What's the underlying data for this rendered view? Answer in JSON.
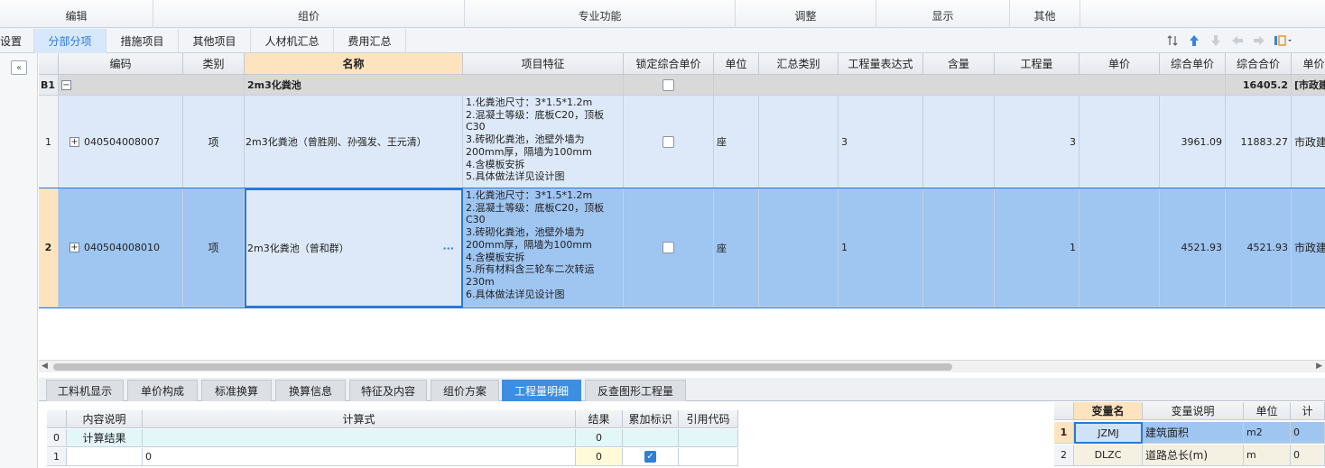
{
  "ribbon": {
    "groups": [
      "编辑",
      "组价",
      "专业功能",
      "调整",
      "显示",
      "其他"
    ]
  },
  "tabs": {
    "items": [
      "设置",
      "分部分项",
      "措施项目",
      "其他项目",
      "人材机汇总",
      "费用汇总"
    ],
    "active": "分部分项"
  },
  "grid": {
    "headers": [
      "编码",
      "类别",
      "名称",
      "项目特征",
      "锁定综合单价",
      "单位",
      "汇总类别",
      "工程量表达式",
      "含量",
      "工程量",
      "单价",
      "综合单价",
      "综合合价",
      "单价"
    ],
    "section": {
      "no": "B1",
      "toggle": "−",
      "name": "2m3化粪池",
      "total": "16405.2",
      "category": "[市政建"
    },
    "rows": [
      {
        "no": "1",
        "code": "040504008007",
        "type": "项",
        "name": "2m3化粪池（曾胜刚、孙强发、王元清）",
        "features": "1.化粪池尺寸：3*1.5*1.2m\n2.混凝土等级：底板C20，顶板\nC30\n3.砖砌化粪池，池壁外墙为\n200mm厚，隔墙为100mm\n4.含模板安拆\n5.具体做法详见设计图",
        "unit": "座",
        "expr": "3",
        "qty": "3",
        "unit_price": "3961.09",
        "total": "11883.27",
        "cat": "市政建"
      },
      {
        "no": "2",
        "code": "040504008010",
        "type": "项",
        "name": "2m3化粪池（曾和群）",
        "more": "···",
        "features": "1.化粪池尺寸：3*1.5*1.2m\n2.混凝土等级：底板C20，顶板\nC30\n3.砖砌化粪池，池壁外墙为\n200mm厚，隔墙为100mm\n4.含模板安拆\n5.所有材料含三轮车二次转运\n230m\n6.具体做法详见设计图",
        "unit": "座",
        "expr": "1",
        "qty": "1",
        "unit_price": "4521.93",
        "total": "4521.93",
        "cat": "市政建"
      }
    ]
  },
  "bottom_tabs": {
    "items": [
      "工料机显示",
      "单价构成",
      "标准换算",
      "换算信息",
      "特征及内容",
      "组价方案",
      "工程量明细",
      "反查图形工程量"
    ],
    "active": "工程量明细"
  },
  "calc_table": {
    "headers": [
      "内容说明",
      "计算式",
      "结果",
      "累加标识",
      "引用代码"
    ],
    "rows": [
      {
        "no": "0",
        "desc": "计算结果",
        "formula": "",
        "result": "0",
        "accumulate": false,
        "ref": ""
      },
      {
        "no": "1",
        "desc": "",
        "formula": "0",
        "result": "0",
        "accumulate": true,
        "ref": ""
      }
    ]
  },
  "var_table": {
    "headers": [
      "变量名",
      "变量说明",
      "单位",
      "计"
    ],
    "rows": [
      {
        "no": "1",
        "name": "JZMJ",
        "desc": "建筑面积",
        "unit": "m2",
        "val": "0"
      },
      {
        "no": "2",
        "name": "DLZC",
        "desc": "道路总长(m)",
        "unit": "m",
        "val": "0"
      }
    ]
  },
  "colors": {
    "accent": "#2b78d8",
    "selected_row": "#9fc5f1",
    "row_bg": "#dde9f8",
    "section_bg": "#d9d9d9",
    "active_tab": "#3d8ee0"
  },
  "icons": [
    "collapse-left-icon",
    "move-up-down-icon",
    "arrow-up-icon",
    "arrow-down-icon",
    "arrow-left-icon",
    "arrow-right-icon",
    "settings-dropdown-icon"
  ]
}
